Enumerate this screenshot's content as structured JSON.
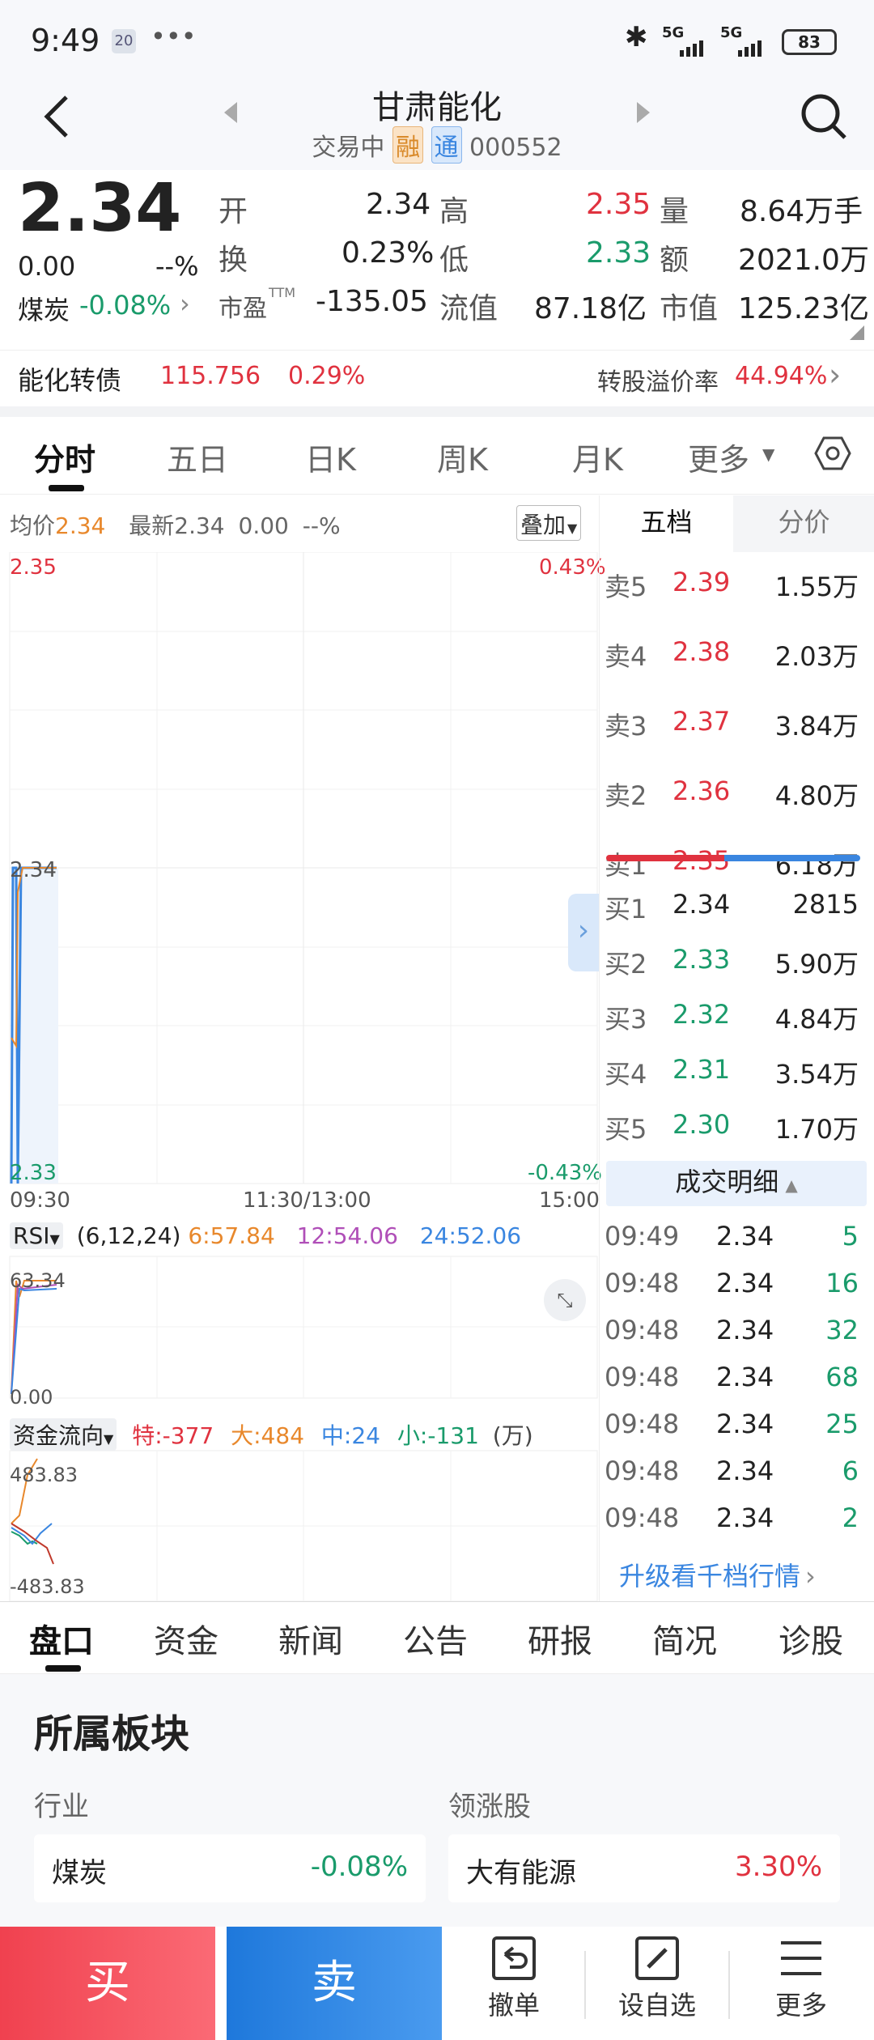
{
  "status": {
    "time": "9:49",
    "notif_badge": "20",
    "dots": "•••",
    "battery": "83",
    "net1": "5G",
    "net2": "5G"
  },
  "header": {
    "title": "甘肃能化",
    "status": "交易中",
    "tag_rong": "融",
    "tag_tong": "通",
    "code": "000552"
  },
  "quote": {
    "price": "2.34",
    "change": "0.00",
    "pct": "--%",
    "open_label": "开",
    "open": "2.34",
    "high_label": "高",
    "high": "2.35",
    "vol_label": "量",
    "vol": "8.64万手",
    "turn_label": "换",
    "turn": "0.23%",
    "low_label": "低",
    "low": "2.33",
    "amt_label": "额",
    "amt": "2021.0万",
    "industry": "煤炭",
    "industry_pct": "-0.08%",
    "pe_label": "市盈",
    "pe_sup": "TTM",
    "pe": "-135.05",
    "float_label": "流值",
    "float": "87.18亿",
    "mcap_label": "市值",
    "mcap": "125.23亿"
  },
  "bond": {
    "name": "能化转债",
    "price": "115.756",
    "pct": "0.29%",
    "premium_label": "转股溢价率",
    "premium": "44.94%"
  },
  "tabs": [
    "分时",
    "五日",
    "日K",
    "周K",
    "月K",
    "更多"
  ],
  "chart": {
    "avg_label": "均价",
    "avg": "2.34",
    "latest_label": "最新",
    "latest": "2.34",
    "chg": "0.00",
    "pct": "--%",
    "overlay": "叠加",
    "top_price": "2.35",
    "top_pct": "0.43%",
    "mid_price": "2.34",
    "bot_price": "2.33",
    "bot_pct": "-0.43%",
    "t1": "09:30",
    "t2": "11:30/13:00",
    "t3": "15:00"
  },
  "rsi": {
    "label": "RSI",
    "params": "(6,12,24)",
    "r6": "6:57.84",
    "r12": "12:54.06",
    "r24": "24:52.06",
    "top": "63.34",
    "bottom": "0.00"
  },
  "flow": {
    "label": "资金流向",
    "te": "特:-377",
    "da": "大:484",
    "zhong": "中:24",
    "xiao": "小:-131",
    "unit": "(万)",
    "top": "483.83",
    "bottom": "-483.83"
  },
  "depth": {
    "tab1": "五档",
    "tab2": "分价",
    "sells": [
      {
        "l": "卖5",
        "p": "2.39",
        "v": "1.55万"
      },
      {
        "l": "卖4",
        "p": "2.38",
        "v": "2.03万"
      },
      {
        "l": "卖3",
        "p": "2.37",
        "v": "3.84万"
      },
      {
        "l": "卖2",
        "p": "2.36",
        "v": "4.80万"
      },
      {
        "l": "卖1",
        "p": "2.35",
        "v": "6.18万"
      }
    ],
    "buys": [
      {
        "l": "买1",
        "p": "2.34",
        "v": "2815"
      },
      {
        "l": "买2",
        "p": "2.33",
        "v": "5.90万"
      },
      {
        "l": "买3",
        "p": "2.32",
        "v": "4.84万"
      },
      {
        "l": "买4",
        "p": "2.31",
        "v": "3.54万"
      },
      {
        "l": "买5",
        "p": "2.30",
        "v": "1.70万"
      }
    ],
    "detail_title": "成交明细",
    "trades": [
      {
        "t": "09:49",
        "p": "2.34",
        "v": "5"
      },
      {
        "t": "09:48",
        "p": "2.34",
        "v": "16"
      },
      {
        "t": "09:48",
        "p": "2.34",
        "v": "32"
      },
      {
        "t": "09:48",
        "p": "2.34",
        "v": "68"
      },
      {
        "t": "09:48",
        "p": "2.34",
        "v": "25"
      },
      {
        "t": "09:48",
        "p": "2.34",
        "v": "6"
      },
      {
        "t": "09:48",
        "p": "2.34",
        "v": "2"
      }
    ],
    "upgrade": "升级看千档行情"
  },
  "bottom_tabs": [
    "盘口",
    "资金",
    "新闻",
    "公告",
    "研报",
    "简况",
    "诊股"
  ],
  "sector": {
    "title": "所属板块",
    "industry_label": "行业",
    "leader_label": "领涨股",
    "industry": "煤炭",
    "industry_pct": "-0.08%",
    "leader": "大有能源",
    "leader_pct": "3.30%"
  },
  "footer": {
    "buy": "买",
    "sell": "卖",
    "cancel": "撤单",
    "watch": "设自选",
    "more": "更多"
  }
}
